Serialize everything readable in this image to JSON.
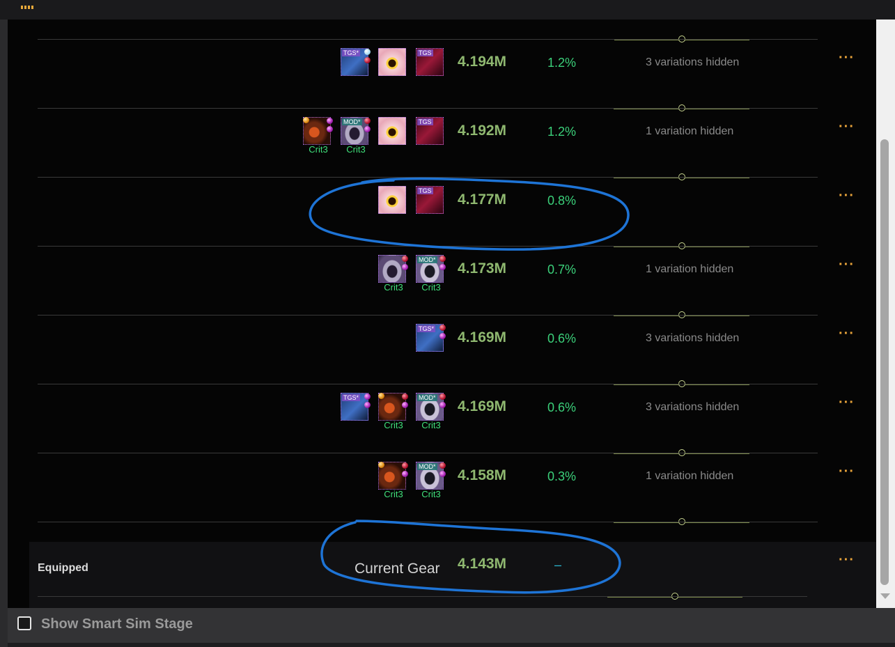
{
  "footer": {
    "show_smart_sim_label": "Show Smart Sim Stage",
    "show_smart_sim_checked": false
  },
  "crit_label": "Crit3",
  "more_label": "···",
  "colors": {
    "dps": "#8fb870",
    "pct": "#3bd07a",
    "menu": "#e8a33a",
    "annotation": "#1e74d6",
    "slider": "#7d8a4c"
  },
  "top_partial_row": {
    "items": [
      {
        "icon": "blue-gear-icon",
        "crit": false
      },
      {
        "icon": "purple-gear-icon",
        "crit": true
      },
      {
        "icon": "purple-gear-icon",
        "crit": true
      }
    ],
    "slider_value": 0.5
  },
  "rows": [
    {
      "dps": "4.194M",
      "pct": "1.2%",
      "hidden": "3 variations hidden",
      "slider_value": 0.5,
      "items": [
        {
          "icon": "blue-trinket-icon",
          "tag": "TGS*",
          "gems": [
            "cyan",
            "red"
          ],
          "crit": false
        },
        {
          "icon": "pink-pendant-icon",
          "crit": false
        },
        {
          "icon": "maroon-trinket-icon",
          "tag": "TGS",
          "crit": false
        }
      ]
    },
    {
      "dps": "4.192M",
      "pct": "1.2%",
      "hidden": "1 variation hidden",
      "slider_value": 0.5,
      "items": [
        {
          "icon": "belt-icon",
          "gems": [
            "orange",
            "purple",
            "purple"
          ],
          "crit": true
        },
        {
          "icon": "ring-icon",
          "tag": "MOD*",
          "gems": [
            "red",
            "purple"
          ],
          "crit": true
        },
        {
          "icon": "pink-pendant-icon",
          "crit": false
        },
        {
          "icon": "maroon-trinket-icon",
          "tag": "TGS",
          "crit": false
        }
      ]
    },
    {
      "dps": "4.177M",
      "pct": "0.8%",
      "hidden": "",
      "slider_value": 0.5,
      "items": [
        {
          "icon": "pink-pendant-icon",
          "crit": false
        },
        {
          "icon": "maroon-trinket-icon",
          "tag": "TGS",
          "crit": false
        }
      ]
    },
    {
      "dps": "4.173M",
      "pct": "0.7%",
      "hidden": "1 variation hidden",
      "slider_value": 0.5,
      "items": [
        {
          "icon": "ring-icon",
          "gems": [
            "red",
            "purple"
          ],
          "crit": true
        },
        {
          "icon": "ring2-icon",
          "tag": "MOD*",
          "gems": [
            "red",
            "purple"
          ],
          "crit": true
        }
      ]
    },
    {
      "dps": "4.169M",
      "pct": "0.6%",
      "hidden": "3 variations hidden",
      "slider_value": 0.5,
      "items": [
        {
          "icon": "blue-trinket-icon",
          "tag": "TGS*",
          "gems": [
            "red",
            "purple"
          ],
          "crit": false
        }
      ]
    },
    {
      "dps": "4.169M",
      "pct": "0.6%",
      "hidden": "3 variations hidden",
      "slider_value": 0.5,
      "items": [
        {
          "icon": "blue-trinket-icon",
          "tag": "TGS*",
          "gems": [
            "purple",
            "purple"
          ],
          "crit": false
        },
        {
          "icon": "belt-icon",
          "gems": [
            "orange",
            "red",
            "purple"
          ],
          "crit": true
        },
        {
          "icon": "ring2-icon",
          "tag": "MOD*",
          "gems": [
            "red",
            "purple"
          ],
          "crit": true
        }
      ]
    },
    {
      "dps": "4.158M",
      "pct": "0.3%",
      "hidden": "1 variation hidden",
      "slider_value": 0.5,
      "items": [
        {
          "icon": "belt-icon",
          "gems": [
            "orange",
            "red",
            "purple"
          ],
          "crit": true
        },
        {
          "icon": "ring2-icon",
          "tag": "MOD*",
          "gems": [
            "red",
            "purple"
          ],
          "crit": true
        }
      ]
    }
  ],
  "equipped": {
    "label": "Equipped",
    "name": "Current Gear",
    "dps": "4.143M",
    "pct": "–",
    "slider_value": 0.5
  }
}
